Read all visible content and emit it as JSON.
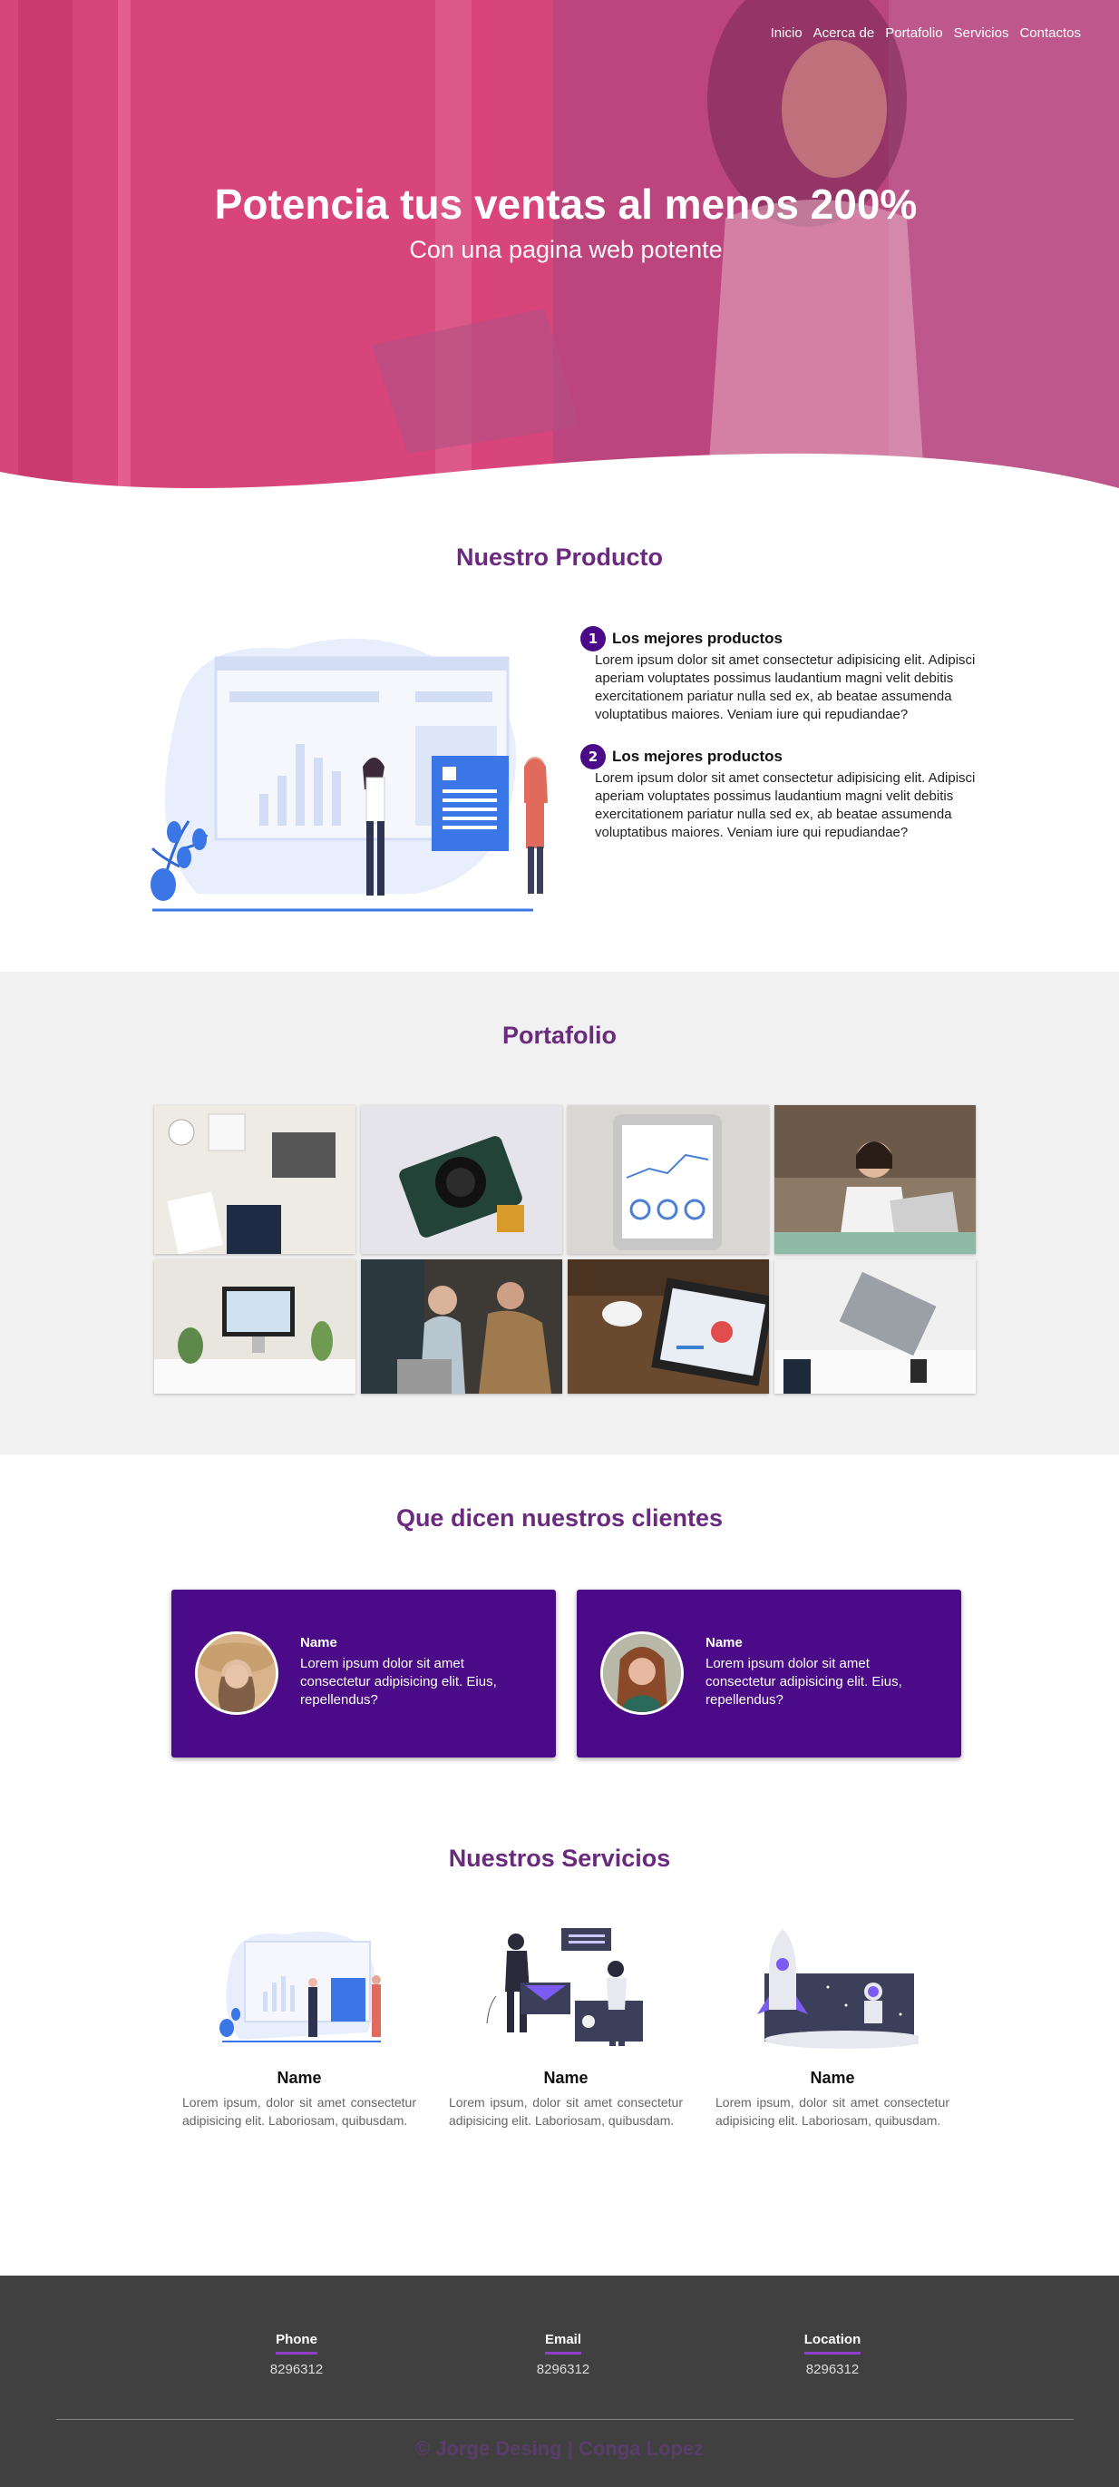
{
  "nav": [
    "Inicio",
    "Acerca de",
    "Portafolio",
    "Servicios",
    "Contactos"
  ],
  "hero": {
    "title": "Potencia tus ventas al menos 200%",
    "subtitle": "Con una pagina web potente"
  },
  "producto": {
    "title": "Nuestro Producto",
    "features": [
      {
        "num": "1",
        "title": "Los mejores productos",
        "text": "Lorem ipsum dolor sit amet consectetur adipisicing elit. Adipisci aperiam voluptates possimus laudantium magni velit debitis exercitationem pariatur nulla sed ex, ab beatae assumenda voluptatibus maiores. Veniam iure qui repudiandae?"
      },
      {
        "num": "2",
        "title": "Los mejores productos",
        "text": "Lorem ipsum dolor sit amet consectetur adipisicing elit. Adipisci aperiam voluptates possimus laudantium magni velit debitis exercitationem pariatur nulla sed ex, ab beatae assumenda voluptatibus maiores. Veniam iure qui repudiandae?"
      }
    ]
  },
  "portafolio": {
    "title": "Portafolio"
  },
  "clientes": {
    "title": "Que dicen nuestros clientes",
    "cards": [
      {
        "name": "Name",
        "text": "Lorem ipsum dolor sit amet consectetur adipisicing elit. Eius, repellendus?"
      },
      {
        "name": "Name",
        "text": "Lorem ipsum dolor sit amet consectetur adipisicing elit. Eius, repellendus?"
      }
    ]
  },
  "servicios": {
    "title": "Nuestros Servicios",
    "items": [
      {
        "name": "Name",
        "text": "Lorem ipsum, dolor sit amet consectetur adipisicing elit. Laboriosam, quibusdam."
      },
      {
        "name": "Name",
        "text": "Lorem ipsum, dolor sit amet consectetur adipisicing elit. Laboriosam, quibusdam."
      },
      {
        "name": "Name",
        "text": "Lorem ipsum, dolor sit amet consectetur adipisicing elit. Laboriosam, quibusdam."
      }
    ]
  },
  "footer": {
    "cols": [
      {
        "heading": "Phone",
        "value": "8296312"
      },
      {
        "heading": "Email",
        "value": "8296312"
      },
      {
        "heading": "Location",
        "value": "8296312"
      }
    ],
    "copyright": "© Jorge Desing | Conga Lopez"
  },
  "colors": {
    "accent": "#4b0a87",
    "title": "#6a2b7e",
    "hero": "#d83a72",
    "footer": "#404040"
  }
}
